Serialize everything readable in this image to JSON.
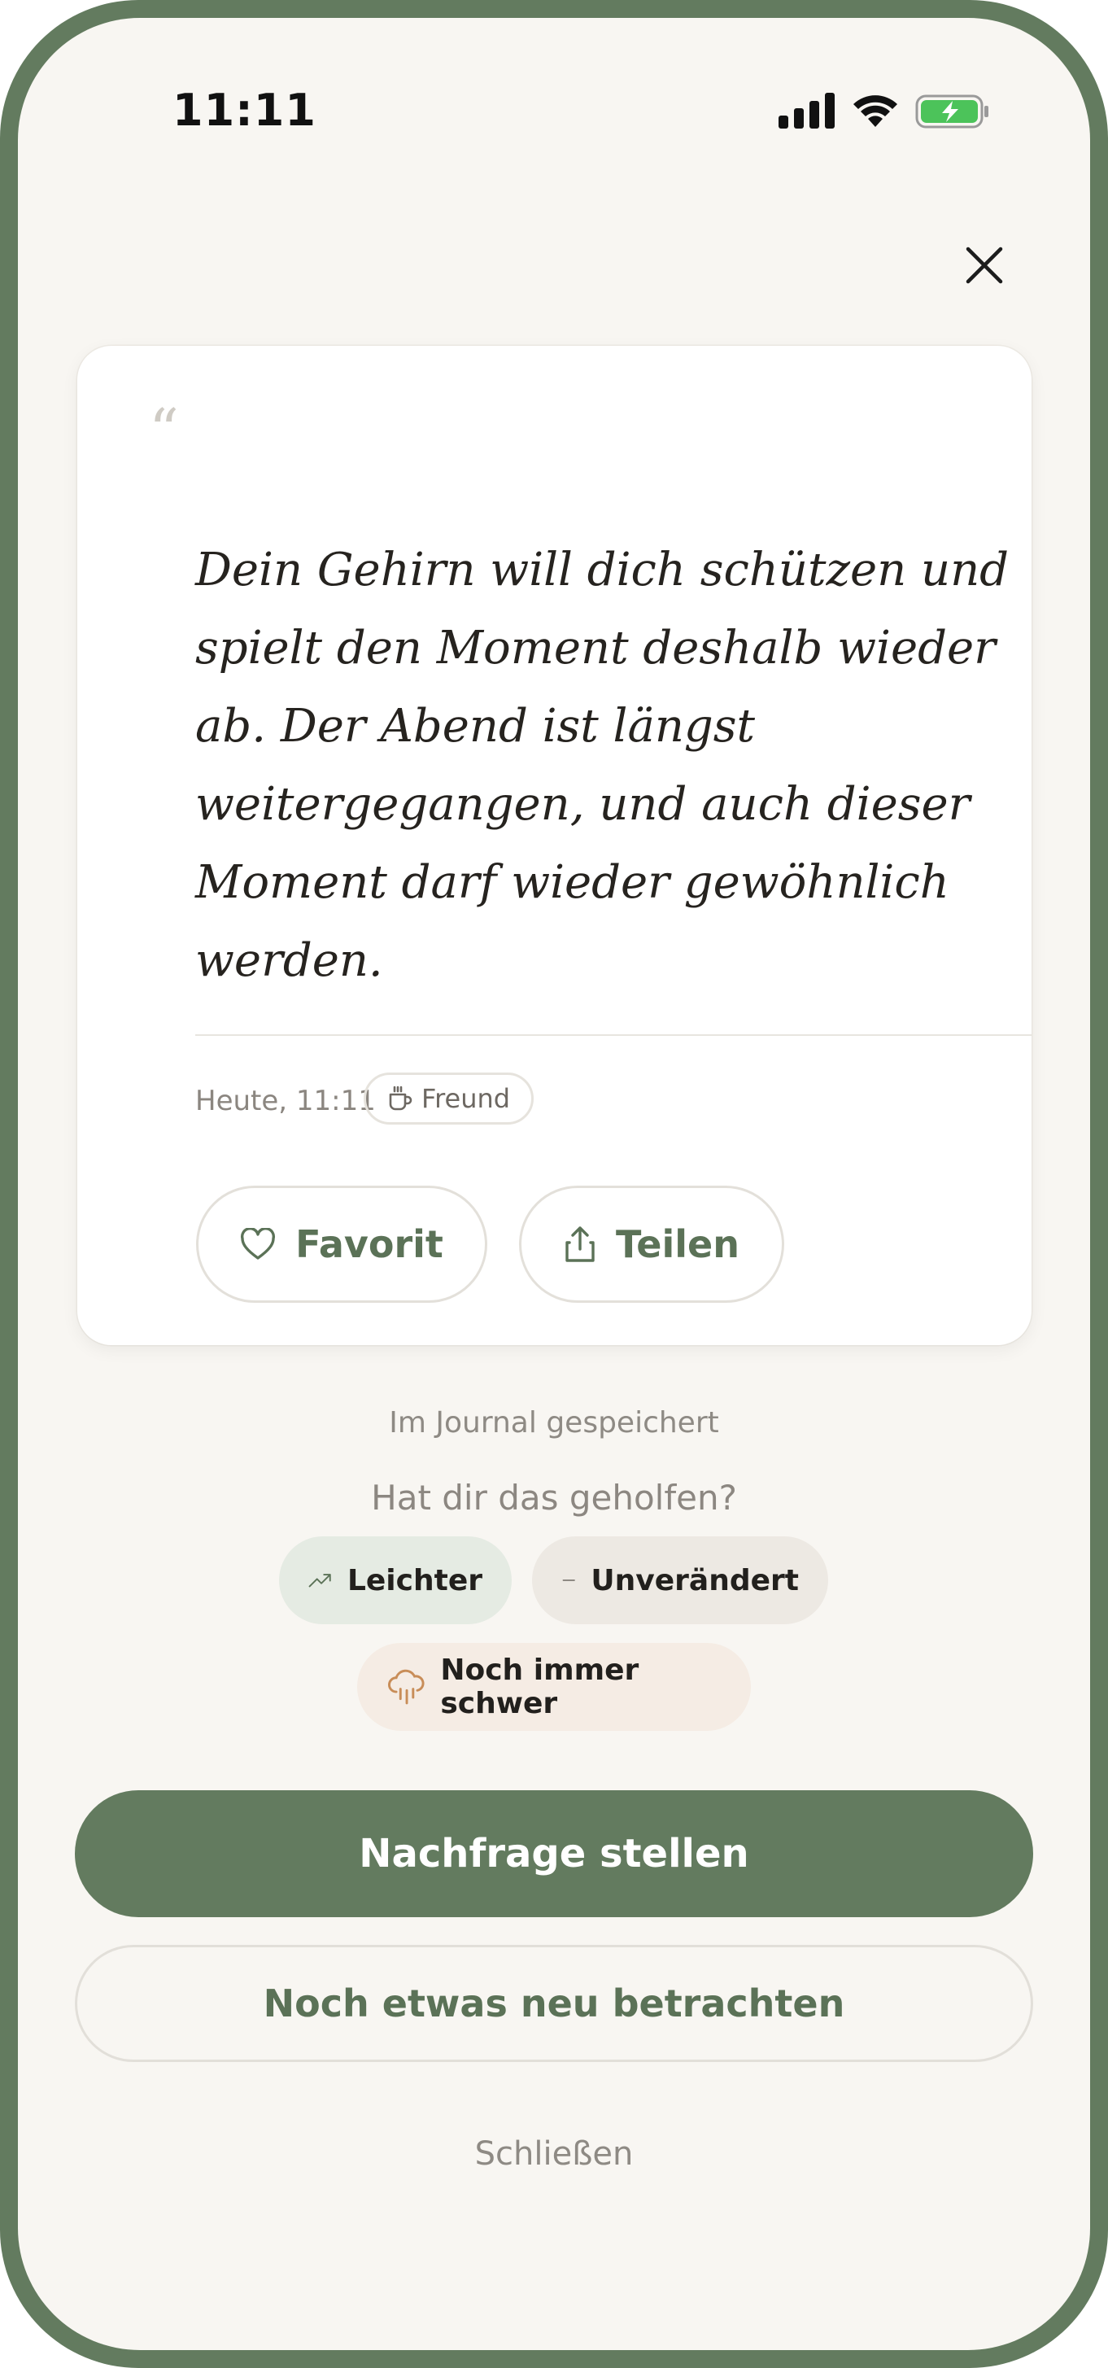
{
  "status_bar": {
    "time": "11:11"
  },
  "card": {
    "quote_mark": "“",
    "quote": "Dein Gehirn will dich schützen und spielt den Moment deshalb wieder ab. Der Abend ist längst weitergegangen, und auch dieser Moment darf wieder gewöhnlich werden.",
    "date": "Heute, 11:11",
    "tag": {
      "icon": "cup-icon",
      "label": "Freund"
    },
    "favorite_label": "Favorit",
    "share_label": "Teilen"
  },
  "saved_text": "Im Journal gespeichert",
  "feedback": {
    "question": "Hat dir das geholfen?",
    "options": [
      {
        "icon": "trending-up-icon",
        "label": "Leichter",
        "color": "#e5ebe3"
      },
      {
        "icon": "minus-icon",
        "label": "Unverändert",
        "color": "#ede9e3"
      },
      {
        "icon": "rain-cloud-icon",
        "label": "Noch immer schwer",
        "color": "#f5ece4"
      }
    ]
  },
  "actions": {
    "primary": "Nachfrage stellen",
    "secondary": "Noch etwas neu betrachten",
    "close": "Schließen"
  },
  "colors": {
    "accent": "#637b5f",
    "background": "#f8f6f2",
    "battery": "#4cc35a"
  }
}
